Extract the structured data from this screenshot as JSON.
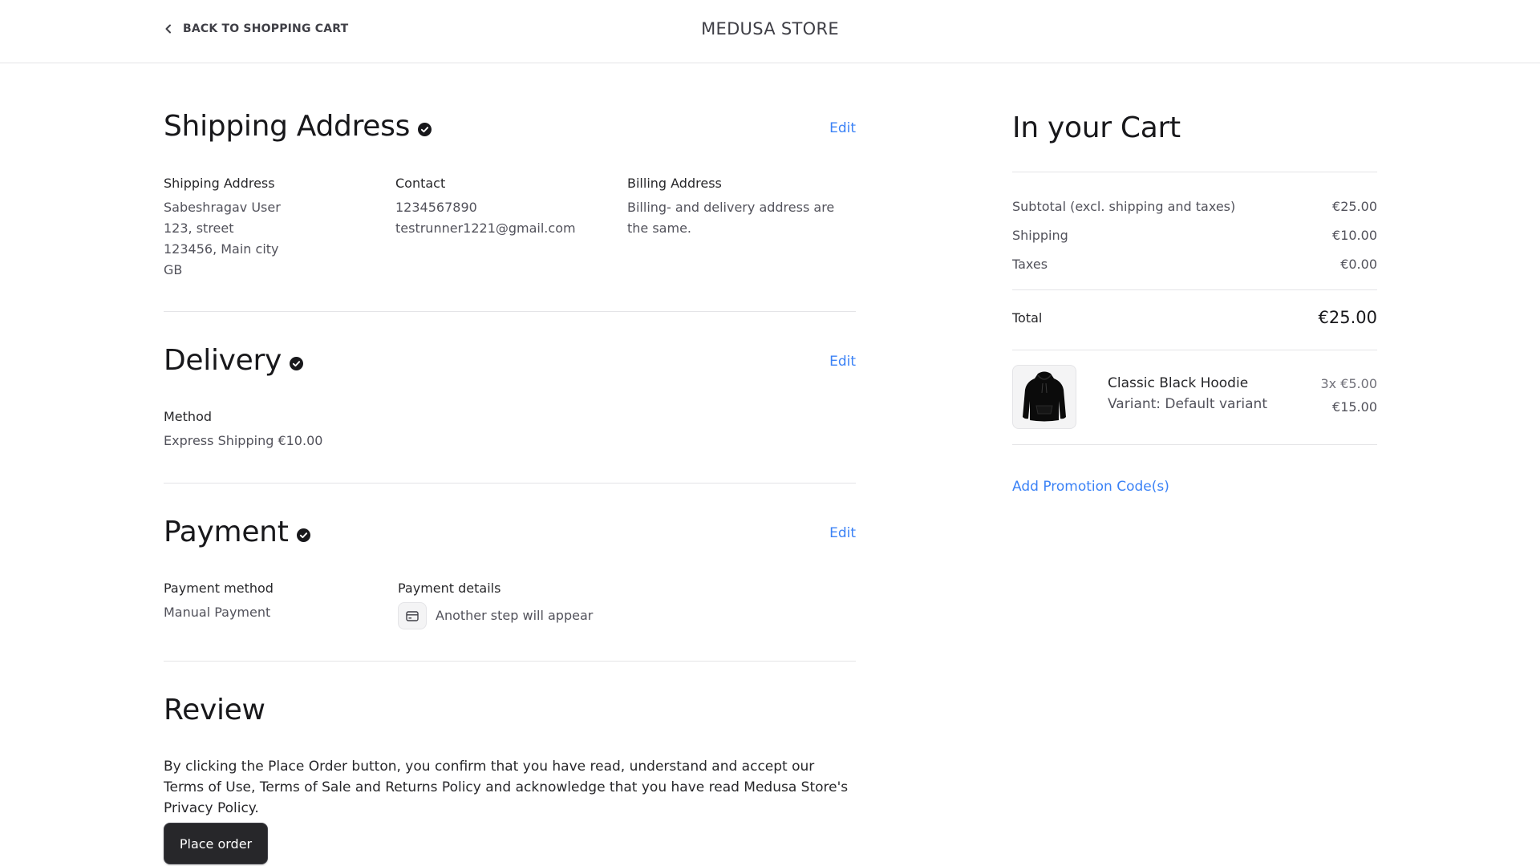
{
  "header": {
    "back_label": "BACK TO SHOPPING CART",
    "store_name": "MEDUSA STORE"
  },
  "shipping": {
    "title": "Shipping Address",
    "edit_label": "Edit",
    "address": {
      "label": "Shipping Address",
      "lines": [
        "Sabeshragav User",
        "123, street",
        "123456, Main city",
        "GB"
      ]
    },
    "contact": {
      "label": "Contact",
      "lines": [
        "1234567890",
        "testrunner1221@gmail.com"
      ]
    },
    "billing": {
      "label": "Billing Address",
      "text": "Billing- and delivery address are the same."
    }
  },
  "delivery": {
    "title": "Delivery",
    "edit_label": "Edit",
    "method_label": "Method",
    "method_value": "Express Shipping €10.00"
  },
  "payment": {
    "title": "Payment",
    "edit_label": "Edit",
    "method_label": "Payment method",
    "method_value": "Manual Payment",
    "details_label": "Payment details",
    "details_value": "Another step will appear",
    "details_icon": "credit-card-icon"
  },
  "review": {
    "title": "Review",
    "text": "By clicking the Place Order button, you confirm that you have read, understand and accept our Terms of Use, Terms of Sale and Returns Policy and acknowledge that you have read Medusa Store's Privacy Policy.",
    "button_label": "Place order"
  },
  "cart": {
    "title": "In your Cart",
    "summary": [
      {
        "label": "Subtotal (excl. shipping and taxes)",
        "value": "€25.00"
      },
      {
        "label": "Shipping",
        "value": "€10.00"
      },
      {
        "label": "Taxes",
        "value": "€0.00"
      }
    ],
    "total_label": "Total",
    "total_value": "€25.00",
    "item": {
      "name": "Classic Black Hoodie",
      "variant": "Variant: Default variant",
      "qty_price": "3x €5.00",
      "line_total": "€15.00"
    },
    "promo_label": "Add Promotion Code(s)"
  },
  "colors": {
    "accent": "#3b82f6",
    "button": "#27272a",
    "divider": "#e4e4e7"
  }
}
